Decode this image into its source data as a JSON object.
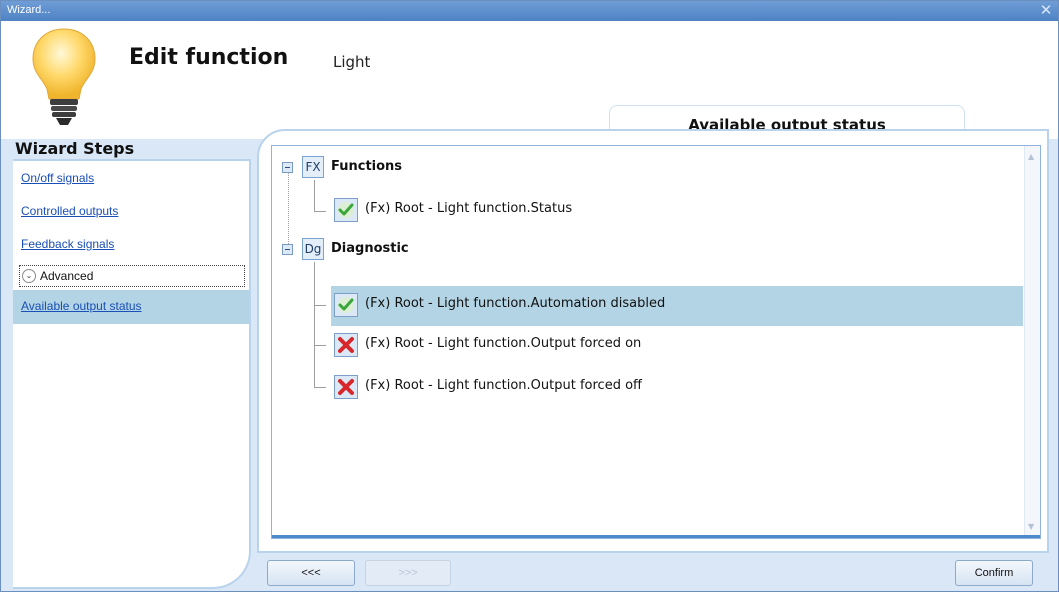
{
  "window": {
    "title": "Wizard...",
    "close_glyph": "✕"
  },
  "header": {
    "title": "Edit function",
    "subtitle": "Light",
    "icon": "light-bulb-icon",
    "tab_title": "Available output status"
  },
  "sidebar": {
    "title": "Wizard Steps",
    "items": [
      {
        "label": "On/off signals"
      },
      {
        "label": "Controlled outputs"
      },
      {
        "label": "Feedback signals"
      }
    ],
    "advanced": {
      "label": "Advanced",
      "chevron_glyph": "⌄"
    },
    "active_item": {
      "label": "Available output status"
    }
  },
  "tree": {
    "groups": [
      {
        "badge": "FX",
        "label": "Functions",
        "items": [
          {
            "label": "(Fx) Root - Light function.Status",
            "status": "enabled",
            "selected": false
          }
        ]
      },
      {
        "badge": "Dg",
        "label": "Diagnostic",
        "items": [
          {
            "label": "(Fx) Root - Light function.Automation disabled",
            "status": "enabled",
            "selected": true
          },
          {
            "label": "(Fx) Root - Light function.Output forced on",
            "status": "disabled",
            "selected": false
          },
          {
            "label": "(Fx) Root - Light function.Output forced off",
            "status": "disabled",
            "selected": false
          }
        ]
      }
    ]
  },
  "footer": {
    "back_label": "<<<",
    "next_label": ">>>",
    "confirm_label": "Confirm"
  },
  "colors": {
    "selection": "#b3d4e4",
    "check_green": "#3aa63a",
    "cross_red": "#d8272b",
    "link_blue": "#1a4fb5",
    "titlebar": "#5b8ccc"
  }
}
